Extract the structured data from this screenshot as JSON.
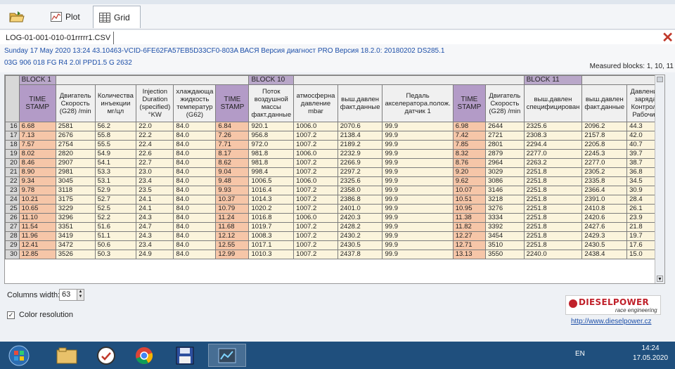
{
  "toolbar": {
    "plot_label": "Plot",
    "grid_label": "Grid"
  },
  "file": {
    "tab_name": "LOG-01-001-010-01rrrrr1.CSV"
  },
  "info": {
    "line1": "Sunday 17 May 2020 13:24 43.10463-VCID-6FE62FA57EB5D33CF0-803A ВАСЯ Версия диагност PRO Версия 18.2.0: 20180202 DS285.1",
    "line2": "03G 906 018 FG  R4 2.0l PPD1.5 G    2632",
    "measured_blocks": "Measured blocks: 1, 10, 11"
  },
  "grid": {
    "blocks": [
      {
        "label": "BLOCK 1",
        "span": 6
      },
      {
        "label": "BLOCK 10",
        "span": 6
      },
      {
        "label": "BLOCK 11",
        "span": 6
      }
    ],
    "headers": [
      "TIME STAMP",
      "Двигатель Скорость (G28) /min",
      "Количества инъекции мг/цл",
      "Injection Duration (specified) °KW",
      "хлаждающа жидкость температур (G62)",
      "TIME STAMP",
      "Поток воздушной массы факт.данные",
      "атмосферна давление mbar",
      "выш.давлен факт.данные",
      "Педаль акселератора.полож. датчик 1",
      "TIME STAMP",
      "Двигатель Скорость (G28) /min",
      "выш.давлен специфицирован",
      "выш.давлен факт.данные",
      "Давление заряда Контроль Рабочий"
    ],
    "rows": [
      {
        "n": "16",
        "c": [
          "6.68",
          "2581",
          "56.2",
          "22.0",
          "84.0",
          "6.84",
          "920.1",
          "1006.0",
          "2070.6",
          "99.9",
          "6.98",
          "2644",
          "2325.6",
          "2096.2",
          "44.3"
        ]
      },
      {
        "n": "17",
        "c": [
          "7.13",
          "2676",
          "55.8",
          "22.2",
          "84.0",
          "7.26",
          "956.8",
          "1007.2",
          "2138.4",
          "99.9",
          "7.42",
          "2721",
          "2308.3",
          "2157.8",
          "42.0"
        ]
      },
      {
        "n": "18",
        "c": [
          "7.57",
          "2754",
          "55.5",
          "22.4",
          "84.0",
          "7.71",
          "972.0",
          "1007.2",
          "2189.2",
          "99.9",
          "7.85",
          "2801",
          "2294.4",
          "2205.8",
          "40.7"
        ]
      },
      {
        "n": "19",
        "c": [
          "8.02",
          "2820",
          "54.9",
          "22.6",
          "84.0",
          "8.17",
          "981.8",
          "1006.0",
          "2232.9",
          "99.9",
          "8.32",
          "2879",
          "2277.0",
          "2245.3",
          "39.7"
        ]
      },
      {
        "n": "20",
        "c": [
          "8.46",
          "2907",
          "54.1",
          "22.7",
          "84.0",
          "8.62",
          "981.8",
          "1007.2",
          "2266.9",
          "99.9",
          "8.76",
          "2964",
          "2263.2",
          "2277.0",
          "38.7"
        ]
      },
      {
        "n": "21",
        "c": [
          "8.90",
          "2981",
          "53.3",
          "23.0",
          "84.0",
          "9.04",
          "998.4",
          "1007.2",
          "2297.2",
          "99.9",
          "9.20",
          "3029",
          "2251.8",
          "2305.2",
          "36.8"
        ]
      },
      {
        "n": "22",
        "c": [
          "9.34",
          "3045",
          "53.1",
          "23.4",
          "84.0",
          "9.48",
          "1006.5",
          "1006.0",
          "2325.6",
          "99.9",
          "9.62",
          "3086",
          "2251.8",
          "2335.8",
          "34.5"
        ]
      },
      {
        "n": "23",
        "c": [
          "9.78",
          "3118",
          "52.9",
          "23.5",
          "84.0",
          "9.93",
          "1016.4",
          "1007.2",
          "2358.0",
          "99.9",
          "10.07",
          "3146",
          "2251.8",
          "2366.4",
          "30.9"
        ]
      },
      {
        "n": "24",
        "c": [
          "10.21",
          "3175",
          "52.7",
          "24.1",
          "84.0",
          "10.37",
          "1014.3",
          "1007.2",
          "2386.8",
          "99.9",
          "10.51",
          "3218",
          "2251.8",
          "2391.0",
          "28.4"
        ]
      },
      {
        "n": "25",
        "c": [
          "10.65",
          "3229",
          "52.5",
          "24.1",
          "84.0",
          "10.79",
          "1020.2",
          "1007.2",
          "2401.0",
          "99.9",
          "10.95",
          "3276",
          "2251.8",
          "2410.8",
          "26.1"
        ]
      },
      {
        "n": "26",
        "c": [
          "11.10",
          "3296",
          "52.2",
          "24.3",
          "84.0",
          "11.24",
          "1016.8",
          "1006.0",
          "2420.3",
          "99.9",
          "11.38",
          "3334",
          "2251.8",
          "2420.6",
          "23.9"
        ]
      },
      {
        "n": "27",
        "c": [
          "11.54",
          "3351",
          "51.6",
          "24.7",
          "84.0",
          "11.68",
          "1019.7",
          "1007.2",
          "2428.2",
          "99.9",
          "11.82",
          "3392",
          "2251.8",
          "2427.6",
          "21.8"
        ]
      },
      {
        "n": "28",
        "c": [
          "11.96",
          "3419",
          "51.1",
          "24.3",
          "84.0",
          "12.12",
          "1008.3",
          "1007.2",
          "2430.2",
          "99.9",
          "12.27",
          "3454",
          "2251.8",
          "2429.3",
          "19.7"
        ]
      },
      {
        "n": "29",
        "c": [
          "12.41",
          "3472",
          "50.6",
          "23.4",
          "84.0",
          "12.55",
          "1017.1",
          "1007.2",
          "2430.5",
          "99.9",
          "12.71",
          "3510",
          "2251.8",
          "2430.5",
          "17.6"
        ]
      },
      {
        "n": "30",
        "c": [
          "12.85",
          "3526",
          "50.3",
          "24.9",
          "84.0",
          "12.99",
          "1010.3",
          "1007.2",
          "2437.8",
          "99.9",
          "13.13",
          "3550",
          "2240.0",
          "2438.4",
          "15.0"
        ]
      }
    ]
  },
  "bottom": {
    "columns_width_label": "Columns width:",
    "columns_width_value": "63",
    "color_resolution_label": "Color resolution",
    "color_resolution_checked": "✓",
    "logo_name": "DIESELPOWER",
    "logo_sub": "race engineering",
    "website": "http://www.dieselpower.cz"
  },
  "taskbar": {
    "lang": "EN",
    "time": "14:24",
    "date": "17.05.2020"
  },
  "icons": [
    "open-folder-icon",
    "plot-icon",
    "grid-icon",
    "close-icon",
    "windows-start-icon",
    "file-explorer-icon",
    "diagnostic-app-icon",
    "chrome-icon",
    "save-icon",
    "app-window-icon"
  ],
  "colors": {
    "timestamp_cell": "#f6c6a8",
    "value_cell": "#fbf4dc",
    "block_header": "#b9a7c9",
    "info_text": "#1d4fa8",
    "taskbar": "#1f4f7d"
  }
}
